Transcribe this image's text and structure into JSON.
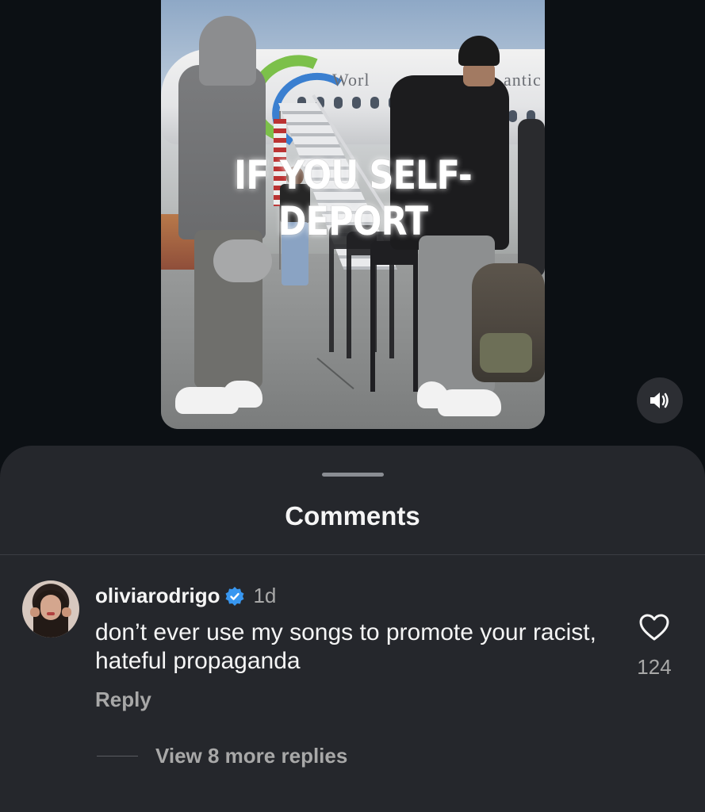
{
  "video": {
    "overlay_caption": "IF YOU SELF-DEPORT",
    "plane_livery_text_left": "Worl",
    "plane_livery_text_right": "antic",
    "mute_icon": "speaker-on-icon"
  },
  "comments_sheet": {
    "title": "Comments"
  },
  "comment": {
    "username": "oliviarodrigo",
    "verified_icon": "verified-badge-icon",
    "verified_color": "#3897f0",
    "time": "1d",
    "text": "don’t ever use my songs to promote your racist, hateful propaganda",
    "reply_label": "Reply",
    "like_icon": "heart-outline-icon",
    "like_count": "124",
    "view_replies_label": "View 8 more replies"
  },
  "colors": {
    "background": "#0c1014",
    "sheet": "#25272c",
    "secondary_text": "#a8a8a8"
  }
}
